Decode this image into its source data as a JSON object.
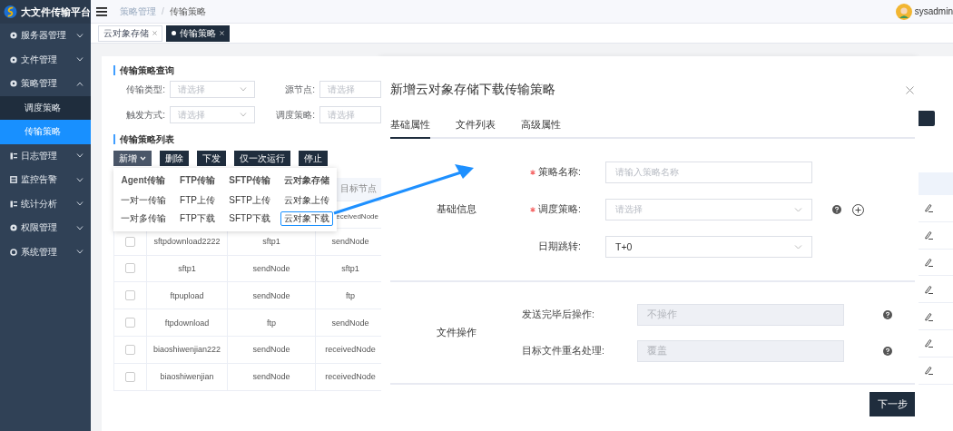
{
  "app": {
    "title": "大文件传输平台"
  },
  "sidebar": {
    "items": [
      {
        "label": "服务器管理",
        "expanded": false
      },
      {
        "label": "文件管理",
        "expanded": false
      },
      {
        "label": "策略管理",
        "expanded": true,
        "children": [
          {
            "label": "调度策略",
            "selected": false
          },
          {
            "label": "传输策略",
            "selected": true
          }
        ]
      },
      {
        "label": "日志管理",
        "expanded": false
      },
      {
        "label": "监控告警",
        "expanded": false
      },
      {
        "label": "统计分析",
        "expanded": false
      },
      {
        "label": "权限管理",
        "expanded": false
      },
      {
        "label": "系统管理",
        "expanded": false
      }
    ]
  },
  "header": {
    "breadcrumb": [
      "策略管理",
      "传输策略"
    ],
    "separator": "/",
    "user": "sysadmin"
  },
  "tabs": [
    {
      "label": "云对象存储",
      "selected": false
    },
    {
      "label": "传输策略",
      "selected": true
    }
  ],
  "query": {
    "title": "传输策略查询",
    "filters": [
      {
        "label": "传输类型:",
        "placeholder": "请选择"
      },
      {
        "label": "源节点:",
        "placeholder": "请选择"
      },
      {
        "label": "触发方式:",
        "placeholder": "请选择"
      },
      {
        "label": "调度策略:",
        "placeholder": "请选择"
      }
    ]
  },
  "list": {
    "title": "传输策略列表",
    "buttons": [
      {
        "label": "新增",
        "kind": "dropdown"
      },
      {
        "label": "删除",
        "kind": "plain"
      },
      {
        "label": "下发",
        "kind": "plain"
      },
      {
        "label": "仅一次运行",
        "kind": "plain"
      },
      {
        "label": "停止",
        "kind": "plain"
      }
    ],
    "menu": [
      {
        "title": "Agent传输",
        "items": [
          {
            "label": "一对一传输",
            "selected": false
          },
          {
            "label": "一对多传输",
            "selected": false
          }
        ]
      },
      {
        "title": "FTP传输",
        "items": [
          {
            "label": "FTP上传",
            "selected": false
          },
          {
            "label": "FTP下载",
            "selected": false
          }
        ]
      },
      {
        "title": "SFTP传输",
        "items": [
          {
            "label": "SFTP上传",
            "selected": false
          },
          {
            "label": "SFTP下载",
            "selected": false
          }
        ]
      },
      {
        "title": "云对象存储",
        "items": [
          {
            "label": "云对象上传",
            "selected": false
          },
          {
            "label": "云对象下载",
            "selected": true
          }
        ]
      }
    ],
    "table": {
      "column_4": "目标节点",
      "rows": [
        {
          "target": "eceivedNode"
        },
        {
          "checked": false,
          "name": "sftpdownload2222",
          "source": "sftp1",
          "target": "sendNode"
        },
        {
          "checked": false,
          "name": "sftp1",
          "source": "sendNode",
          "target": "sftp1"
        },
        {
          "checked": false,
          "name": "ftpupload",
          "source": "sendNode",
          "target": "ftp"
        },
        {
          "checked": false,
          "name": "ftpdownload",
          "source": "ftp",
          "target": "sendNode"
        },
        {
          "checked": false,
          "name": "biaoshiwenjian222",
          "source": "sendNode",
          "target": "receivedNode"
        },
        {
          "checked": false,
          "name": "biaoshiwenjian",
          "source": "sendNode",
          "target": "receivedNode"
        }
      ]
    }
  },
  "dialog": {
    "title": "新增云对象存储下载传输策略",
    "tabs": [
      {
        "label": "基础属性",
        "selected": true
      },
      {
        "label": "文件列表",
        "selected": false
      },
      {
        "label": "高级属性",
        "selected": false
      }
    ],
    "sections": [
      {
        "title": "基础信息",
        "fields": [
          {
            "label": "策略名称:",
            "required": true,
            "kind": "input",
            "placeholder": "请输入策略名称",
            "disabled": false,
            "help": false,
            "add": false
          },
          {
            "label": "调度策略:",
            "required": true,
            "kind": "select",
            "placeholder": "请选择",
            "disabled": false,
            "help": true,
            "add": true
          },
          {
            "label": "日期跳转:",
            "required": false,
            "kind": "select",
            "value": "T+0",
            "disabled": false,
            "help": false,
            "add": false
          }
        ]
      },
      {
        "title": "文件操作",
        "fields": [
          {
            "label": "发送完毕后操作:",
            "required": false,
            "kind": "input",
            "value": "不操作",
            "disabled": true,
            "help": true,
            "add": false
          },
          {
            "label": "目标文件重名处理:",
            "required": false,
            "kind": "input",
            "value": "覆盖",
            "disabled": true,
            "help": true,
            "add": false
          }
        ]
      }
    ],
    "next_button": "下一步"
  }
}
